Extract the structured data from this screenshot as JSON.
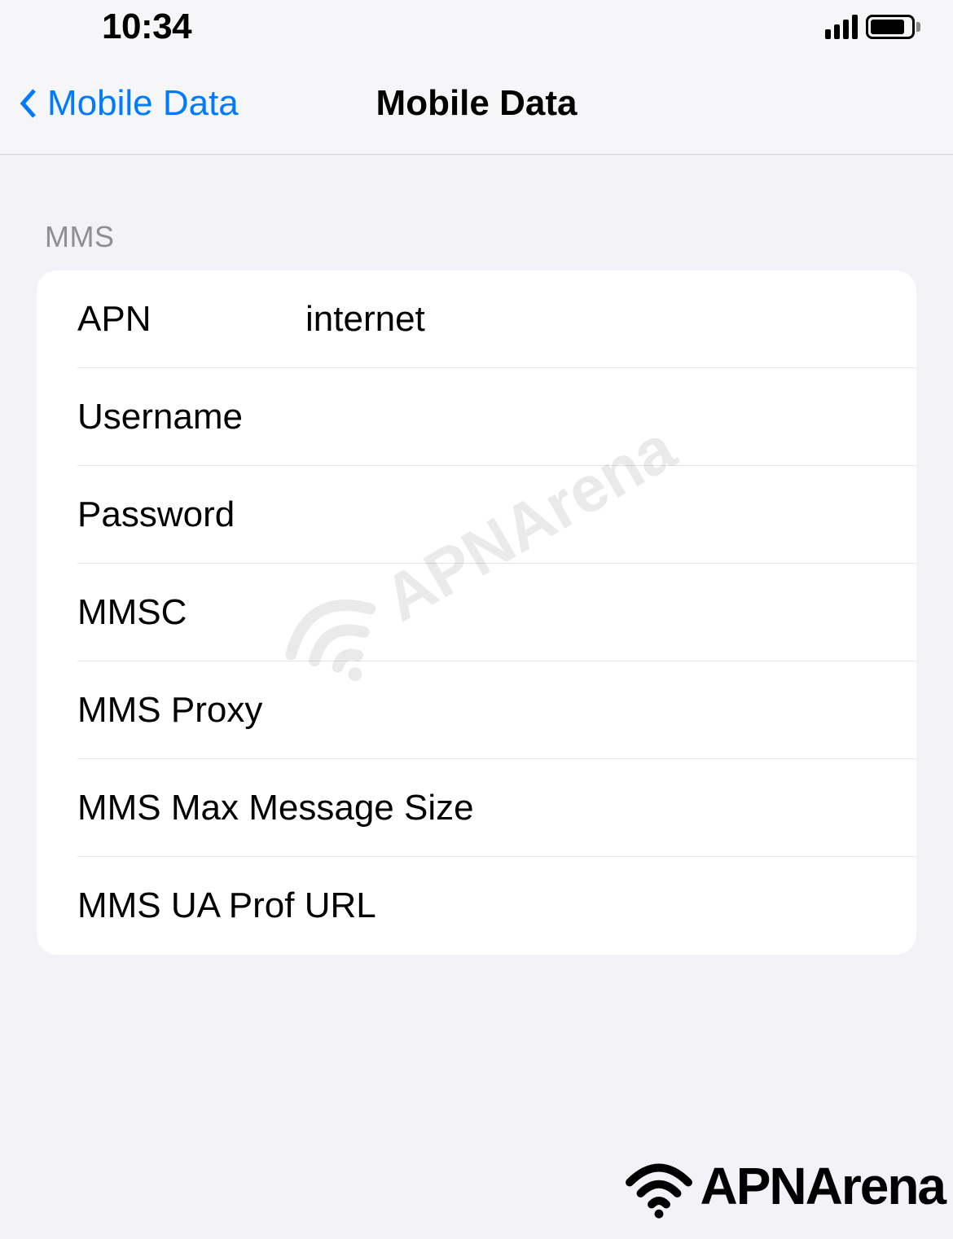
{
  "status_bar": {
    "time": "10:34"
  },
  "nav": {
    "back_label": "Mobile Data",
    "title": "Mobile Data"
  },
  "section": {
    "header": "MMS",
    "rows": [
      {
        "label": "APN",
        "value": "internet"
      },
      {
        "label": "Username",
        "value": ""
      },
      {
        "label": "Password",
        "value": ""
      },
      {
        "label": "MMSC",
        "value": ""
      },
      {
        "label": "MMS Proxy",
        "value": ""
      },
      {
        "label": "MMS Max Message Size",
        "value": ""
      },
      {
        "label": "MMS UA Prof URL",
        "value": ""
      }
    ]
  },
  "watermark": {
    "text": "APNArena"
  },
  "footer": {
    "text": "APNArena"
  }
}
